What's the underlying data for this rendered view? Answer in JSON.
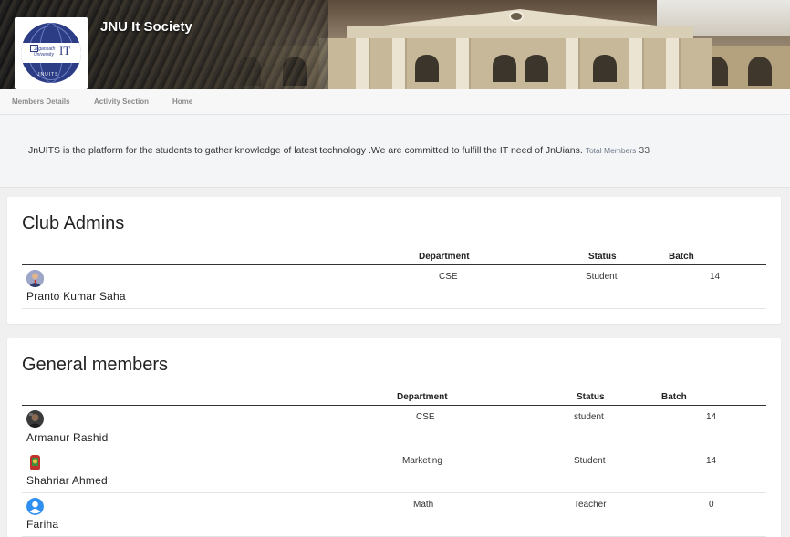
{
  "header": {
    "site_title": "JNU It Society",
    "logo_text_top": "Jagannath University",
    "logo_text_it": "IT",
    "logo_text_bottom": "JNUITS"
  },
  "nav": {
    "items": [
      "Members Details",
      "Activity Section",
      "Home"
    ]
  },
  "intro": {
    "text": "JnUITS is the platform for the students to gather knowledge of latest technology .We are committed to fulfill the IT need of JnUians.",
    "total_members_label": "Total Members",
    "total_members_value": "33"
  },
  "admins": {
    "title": "Club Admins",
    "columns": {
      "department": "Department",
      "status": "Status",
      "batch": "Batch"
    },
    "rows": [
      {
        "name": "Pranto Kumar Saha",
        "department": "CSE",
        "status": "Student",
        "batch": "14",
        "avatar": "admin-avatar-icon"
      }
    ]
  },
  "members": {
    "title": "General members",
    "columns": {
      "department": "Department",
      "status": "Status",
      "batch": "Batch"
    },
    "rows": [
      {
        "name": "Armanur Rashid",
        "department": "CSE",
        "status": "student",
        "batch": "14",
        "avatar": "photo-avatar-icon"
      },
      {
        "name": "Shahriar Ahmed",
        "department": "Marketing",
        "status": "Student",
        "batch": "14",
        "avatar": "photo-avatar-icon"
      },
      {
        "name": "Fariha",
        "department": "Math",
        "status": "Teacher",
        "batch": "0",
        "avatar": "default-user-icon"
      }
    ]
  },
  "colors": {
    "title_text": "#ffffff",
    "nav_text": "#8a8a8a",
    "default_avatar": "#2f8ff0"
  }
}
